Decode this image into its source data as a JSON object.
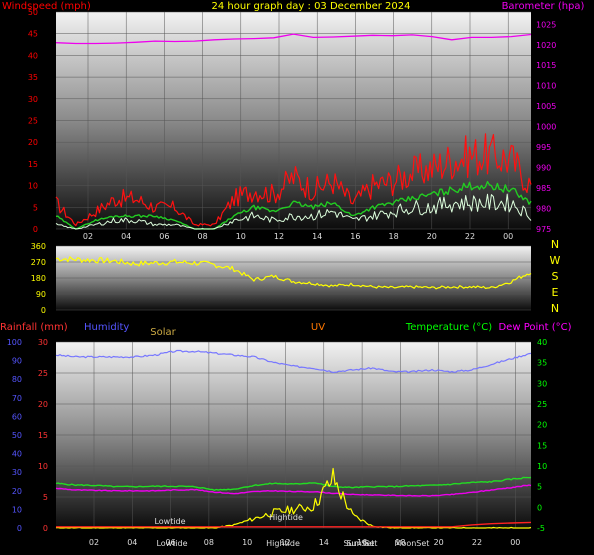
{
  "chart_data": [
    {
      "type": "line",
      "title": "24 hour graph day : 03 December 2024",
      "ylabel": "Windspeed (mph)",
      "y2label": "Barometer (hpa)",
      "ylim": [
        0,
        50
      ],
      "y2lim": [
        975,
        1028
      ],
      "yticks": [
        0,
        5,
        10,
        15,
        20,
        25,
        30,
        35,
        40,
        45,
        50
      ],
      "y2ticks": [
        975,
        980,
        985,
        990,
        995,
        1000,
        1005,
        1010,
        1015,
        1020,
        1025
      ],
      "xticks": [
        "02",
        "04",
        "06",
        "08",
        "10",
        "12",
        "14",
        "16",
        "18",
        "20",
        "22",
        "00"
      ],
      "x": [
        0,
        1,
        2,
        3,
        4,
        5,
        6,
        7,
        8,
        9,
        10,
        11,
        12,
        13,
        14,
        15,
        16,
        17,
        18,
        19,
        20,
        21,
        22,
        23,
        24
      ],
      "series": [
        {
          "values": [
            6,
            1,
            4,
            7,
            7,
            5,
            5,
            1,
            1,
            7,
            9,
            8,
            12,
            9,
            11,
            6,
            10,
            11,
            13,
            14,
            16,
            17,
            17,
            16,
            10
          ]
        },
        {
          "values": [
            3,
            0,
            2,
            3,
            3,
            3,
            2,
            0,
            0,
            3,
            5,
            4,
            6,
            5,
            6,
            3,
            5,
            6,
            7,
            8,
            9,
            10,
            10,
            9,
            6
          ]
        },
        {
          "values": [
            1,
            0,
            1,
            2,
            2,
            1,
            1,
            0,
            0,
            2,
            3,
            2,
            3,
            3,
            4,
            2,
            3,
            4,
            5,
            5,
            6,
            6,
            6,
            6,
            3
          ]
        },
        {
          "values": [
            1020.5,
            1020.3,
            1020.3,
            1020.4,
            1020.6,
            1020.9,
            1020.8,
            1020.9,
            1021.2,
            1021.4,
            1021.5,
            1021.7,
            1022.6,
            1021.8,
            1021.9,
            1022.1,
            1022.3,
            1022.2,
            1022.4,
            1022.0,
            1021.2,
            1021.8,
            1021.8,
            1022.0,
            1022.5
          ]
        }
      ]
    },
    {
      "type": "line",
      "ylim": [
        0,
        360
      ],
      "yticks": [
        0,
        90,
        180,
        270,
        360
      ],
      "compass": [
        "N",
        "W",
        "S",
        "E",
        "N"
      ],
      "x": [
        0,
        1,
        2,
        3,
        4,
        5,
        6,
        7,
        8,
        9,
        10,
        11,
        12,
        13,
        14,
        15,
        16,
        17,
        18,
        19,
        20,
        21,
        22,
        23,
        24
      ],
      "series": [
        {
          "values": [
            290,
            285,
            280,
            275,
            260,
            265,
            270,
            265,
            255,
            230,
            170,
            190,
            160,
            150,
            135,
            145,
            130,
            125,
            130,
            125,
            130,
            130,
            125,
            160,
            215
          ]
        }
      ]
    },
    {
      "type": "line",
      "ylabel": "Rainfall (mm)",
      "y2label": "Humidity",
      "y3label": "Solar",
      "y4label": "UV",
      "y5label": "Temperature (°C)",
      "y6label": "Dew Point (°C)",
      "ylim": [
        0,
        30
      ],
      "yticks": [
        0,
        5,
        10,
        15,
        20,
        25,
        30
      ],
      "humidity_ticks": [
        0,
        10,
        20,
        30,
        40,
        50,
        60,
        70,
        80,
        90,
        100
      ],
      "temp_lim": [
        -5,
        40
      ],
      "temp_ticks": [
        -5,
        0,
        5,
        10,
        15,
        20,
        25,
        30,
        35,
        40
      ],
      "xticks": [
        "02",
        "04",
        "06",
        "08",
        "10",
        "12",
        "14",
        "16",
        "18",
        "20",
        "22",
        "00"
      ],
      "x": [
        0,
        1,
        2,
        3,
        4,
        5,
        6,
        7,
        8,
        9,
        10,
        11,
        12,
        13,
        14,
        15,
        16,
        17,
        18,
        19,
        20,
        21,
        22,
        23,
        24
      ],
      "series": [
        {
          "name": "Humidity",
          "values": [
            93,
            92,
            92,
            92,
            92,
            93,
            95,
            95,
            94,
            93,
            92,
            89,
            87,
            86,
            84,
            85,
            86,
            84,
            84,
            85,
            84,
            85,
            88,
            91,
            94
          ]
        },
        {
          "name": "Temperature (°C)",
          "values": [
            5.8,
            5.4,
            5.3,
            5.0,
            5.0,
            5.1,
            5.1,
            5.0,
            4.2,
            4.4,
            5.3,
            5.8,
            5.6,
            6.0,
            5.0,
            4.8,
            5.0,
            5.0,
            5.2,
            5.3,
            5.6,
            6.0,
            6.2,
            6.8,
            7.3
          ]
        },
        {
          "name": "Dew Point (°C)",
          "values": [
            4.6,
            4.2,
            4.1,
            4.0,
            4.0,
            4.0,
            4.2,
            4.3,
            3.7,
            3.3,
            3.8,
            4.0,
            3.8,
            3.8,
            3.4,
            3.1,
            3.0,
            2.9,
            2.8,
            2.8,
            3.1,
            3.6,
            4.2,
            4.8,
            5.4
          ]
        },
        {
          "name": "Solar",
          "values": [
            0,
            0,
            0,
            0,
            0,
            0,
            0,
            0,
            0,
            0.5,
            1.5,
            2.5,
            3,
            3.5,
            8,
            2,
            0.3,
            0,
            0,
            0,
            0,
            0,
            0,
            0,
            0
          ]
        },
        {
          "name": "Rainfall (mm)",
          "values": [
            0.2,
            0.2,
            0.2,
            0.2,
            0.2,
            0.2,
            0.2,
            0.2,
            0.2,
            0.2,
            0.2,
            0.2,
            0.2,
            0.2,
            0.2,
            0.2,
            0.2,
            0.2,
            0.2,
            0.2,
            0.2,
            0.5,
            0.7,
            0.8,
            0.9
          ]
        }
      ],
      "annotations": [
        "Lowtide",
        "Lowtide",
        "Hightide",
        "Hightide",
        "Sun Set",
        "Sun Set",
        "MoonSet"
      ]
    }
  ],
  "colors": {
    "wind_gust": "#ff1111",
    "wind_avg": "#22cc22",
    "wind_min": "#ddffdd",
    "barometer": "#ee00ee",
    "direction": "#ffff00",
    "humidity": "#7777ff",
    "temperature": "#22dd22",
    "dewpoint": "#ee00ee",
    "solar": "#ffff00",
    "rainfall": "#ff2222",
    "title": "#ffff00",
    "windspeed_label": "#ff0000",
    "compass": "#ffff00",
    "rain_axis": "#ff3333",
    "hum_axis": "#5555ff",
    "uv_label": "#ff7700",
    "solar_label": "#ccaa44",
    "temp_axis": "#00ff00",
    "dew_label": "#ff00ff"
  }
}
